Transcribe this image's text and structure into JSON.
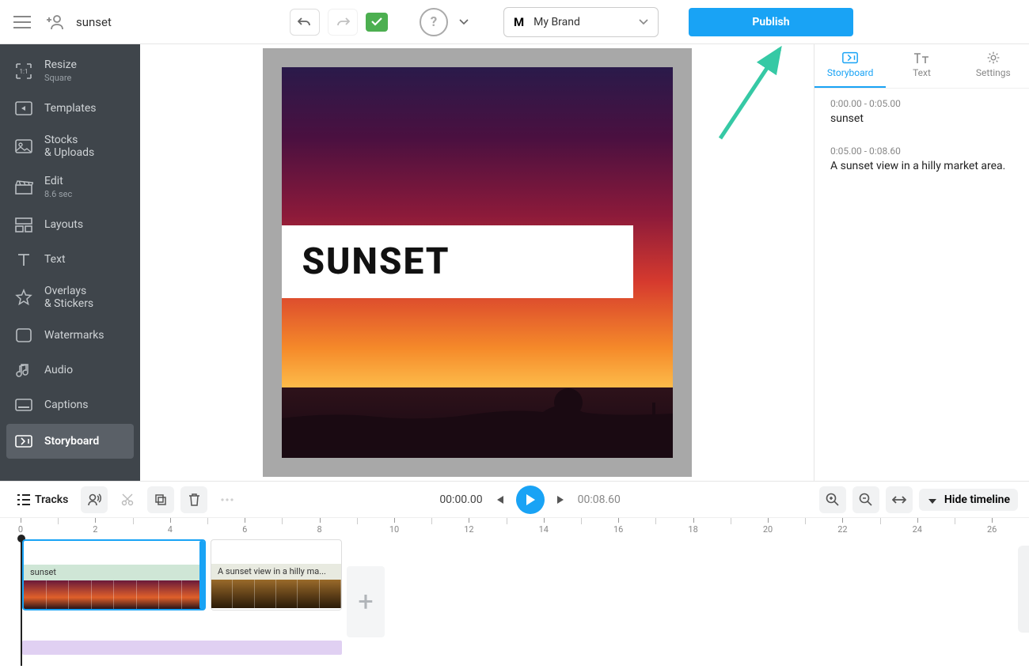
{
  "topbar": {
    "title": "sunset",
    "brand_letter": "M",
    "brand_name": "My Brand",
    "publish_label": "Publish"
  },
  "sidebar": {
    "items": [
      {
        "label": "Resize",
        "sub": "Square",
        "icon": "resize"
      },
      {
        "label": "Templates",
        "icon": "templates"
      },
      {
        "label": "Stocks\n& Uploads",
        "icon": "image"
      },
      {
        "label": "Edit",
        "sub": "8.6 sec",
        "icon": "clapper"
      },
      {
        "label": "Layouts",
        "icon": "layouts"
      },
      {
        "label": "Text",
        "icon": "text"
      },
      {
        "label": "Overlays\n& Stickers",
        "icon": "star"
      },
      {
        "label": "Watermarks",
        "icon": "watermark"
      },
      {
        "label": "Audio",
        "icon": "audio"
      },
      {
        "label": "Captions",
        "icon": "captions"
      },
      {
        "label": "Storyboard",
        "icon": "storyboard"
      }
    ]
  },
  "canvas": {
    "title": "SUNSET"
  },
  "right_panel": {
    "tabs": [
      {
        "label": "Storyboard"
      },
      {
        "label": "Text"
      },
      {
        "label": "Settings"
      }
    ],
    "scenes": [
      {
        "time": "0:00.00 - 0:05.00",
        "text": "sunset"
      },
      {
        "time": "0:05.00 - 0:08.60",
        "text": "A sunset view in a hilly market area."
      }
    ]
  },
  "timeline_controls": {
    "tracks_label": "Tracks",
    "current_time": "00:00.00",
    "total_time": "00:08.60",
    "hide_label": "Hide timeline"
  },
  "ruler": {
    "major_ticks": [
      0,
      2,
      4,
      6,
      8,
      10,
      12,
      14,
      16,
      18,
      20,
      22,
      24,
      26
    ]
  },
  "clips": [
    {
      "label": "sunset"
    },
    {
      "label": "A sunset view in a hilly ma..."
    }
  ]
}
